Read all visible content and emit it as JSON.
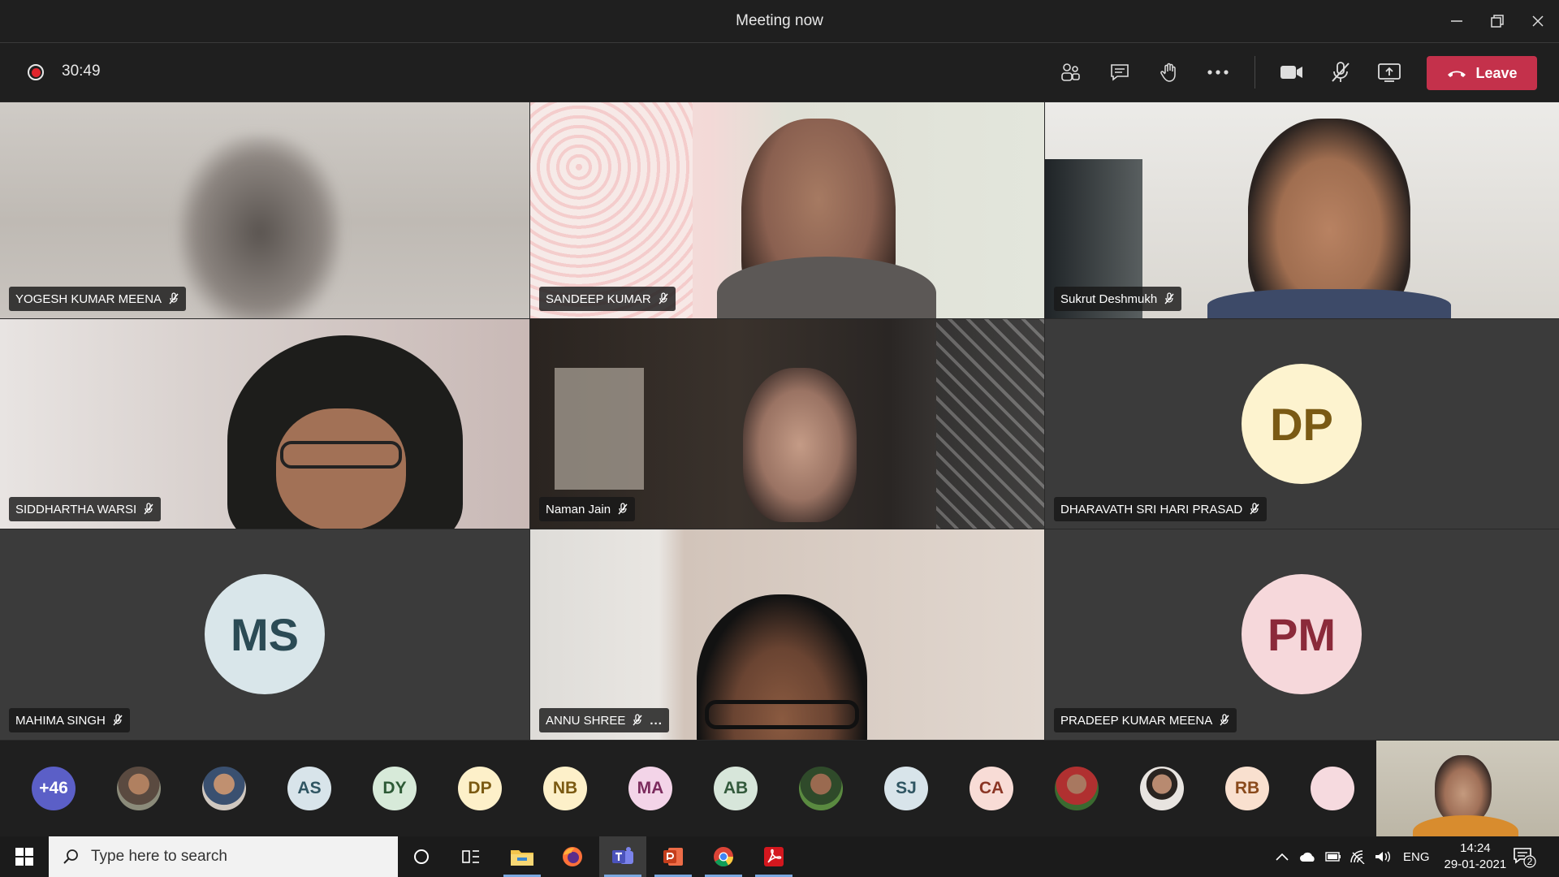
{
  "window": {
    "title": "Meeting now",
    "controls": [
      "minimize-icon",
      "restore-icon",
      "close-icon"
    ]
  },
  "toolbar": {
    "recording_timer": "30:49",
    "icons": [
      "participants-icon",
      "chat-icon",
      "raise-hand-icon",
      "more-options-icon",
      "camera-icon",
      "mic-muted-icon",
      "share-screen-icon"
    ],
    "leave_label": "Leave",
    "leave_color": "#c4314b"
  },
  "tiles": [
    {
      "name": "YOGESH KUMAR MEENA",
      "type": "video"
    },
    {
      "name": "SANDEEP KUMAR",
      "type": "video"
    },
    {
      "name": "Sukrut Deshmukh",
      "type": "video"
    },
    {
      "name": "SIDDHARTHA WARSI",
      "type": "video"
    },
    {
      "name": "Naman Jain",
      "type": "video"
    },
    {
      "name": "DHARAVATH SRI HARI PRASAD",
      "type": "avatar",
      "initials": "DP",
      "bg": "#fdf3cf",
      "fg": "#7a5a14"
    },
    {
      "name": "MAHIMA SINGH",
      "type": "avatar",
      "initials": "MS",
      "bg": "#d9e6ea",
      "fg": "#2b4b55"
    },
    {
      "name": "ANNU SHREE",
      "type": "video",
      "more": "..."
    },
    {
      "name": "PRADEEP KUMAR MEENA",
      "type": "avatar",
      "initials": "PM",
      "bg": "#f6d8db",
      "fg": "#8b2a3a"
    }
  ],
  "strip": {
    "overflow": "+46",
    "avatars": [
      {
        "kind": "photo"
      },
      {
        "kind": "photo"
      },
      {
        "initials": "AS",
        "bg": "#d8e4ea",
        "fg": "#2f5562"
      },
      {
        "initials": "DY",
        "bg": "#d7ead9",
        "fg": "#2d5a36"
      },
      {
        "initials": "DP",
        "bg": "#fdf0c9",
        "fg": "#7b5a12"
      },
      {
        "initials": "NB",
        "bg": "#fdf0c9",
        "fg": "#7b5a12"
      },
      {
        "initials": "MA",
        "bg": "#f3d4e8",
        "fg": "#7b2b5d"
      },
      {
        "initials": "AB",
        "bg": "#d7e6da",
        "fg": "#335a3c"
      },
      {
        "kind": "photo"
      },
      {
        "initials": "SJ",
        "bg": "#d8e4ea",
        "fg": "#2f5562"
      },
      {
        "initials": "CA",
        "bg": "#f8dcd6",
        "fg": "#8a3524"
      },
      {
        "kind": "photo"
      },
      {
        "kind": "photo"
      },
      {
        "initials": "RB",
        "bg": "#f9e0cf",
        "fg": "#8a4a1c"
      },
      {
        "initials": "",
        "bg": "#f6dadf",
        "fg": "#8b2a3a"
      }
    ]
  },
  "taskbar": {
    "search_placeholder": "Type here to search",
    "apps": [
      "cortana-icon",
      "task-view-icon",
      "file-explorer-icon",
      "firefox-icon",
      "teams-icon",
      "powerpoint-icon",
      "chrome-icon",
      "acrobat-icon"
    ],
    "language": "ENG",
    "time": "14:24",
    "date": "29-01-2021",
    "notification_count": "2"
  }
}
